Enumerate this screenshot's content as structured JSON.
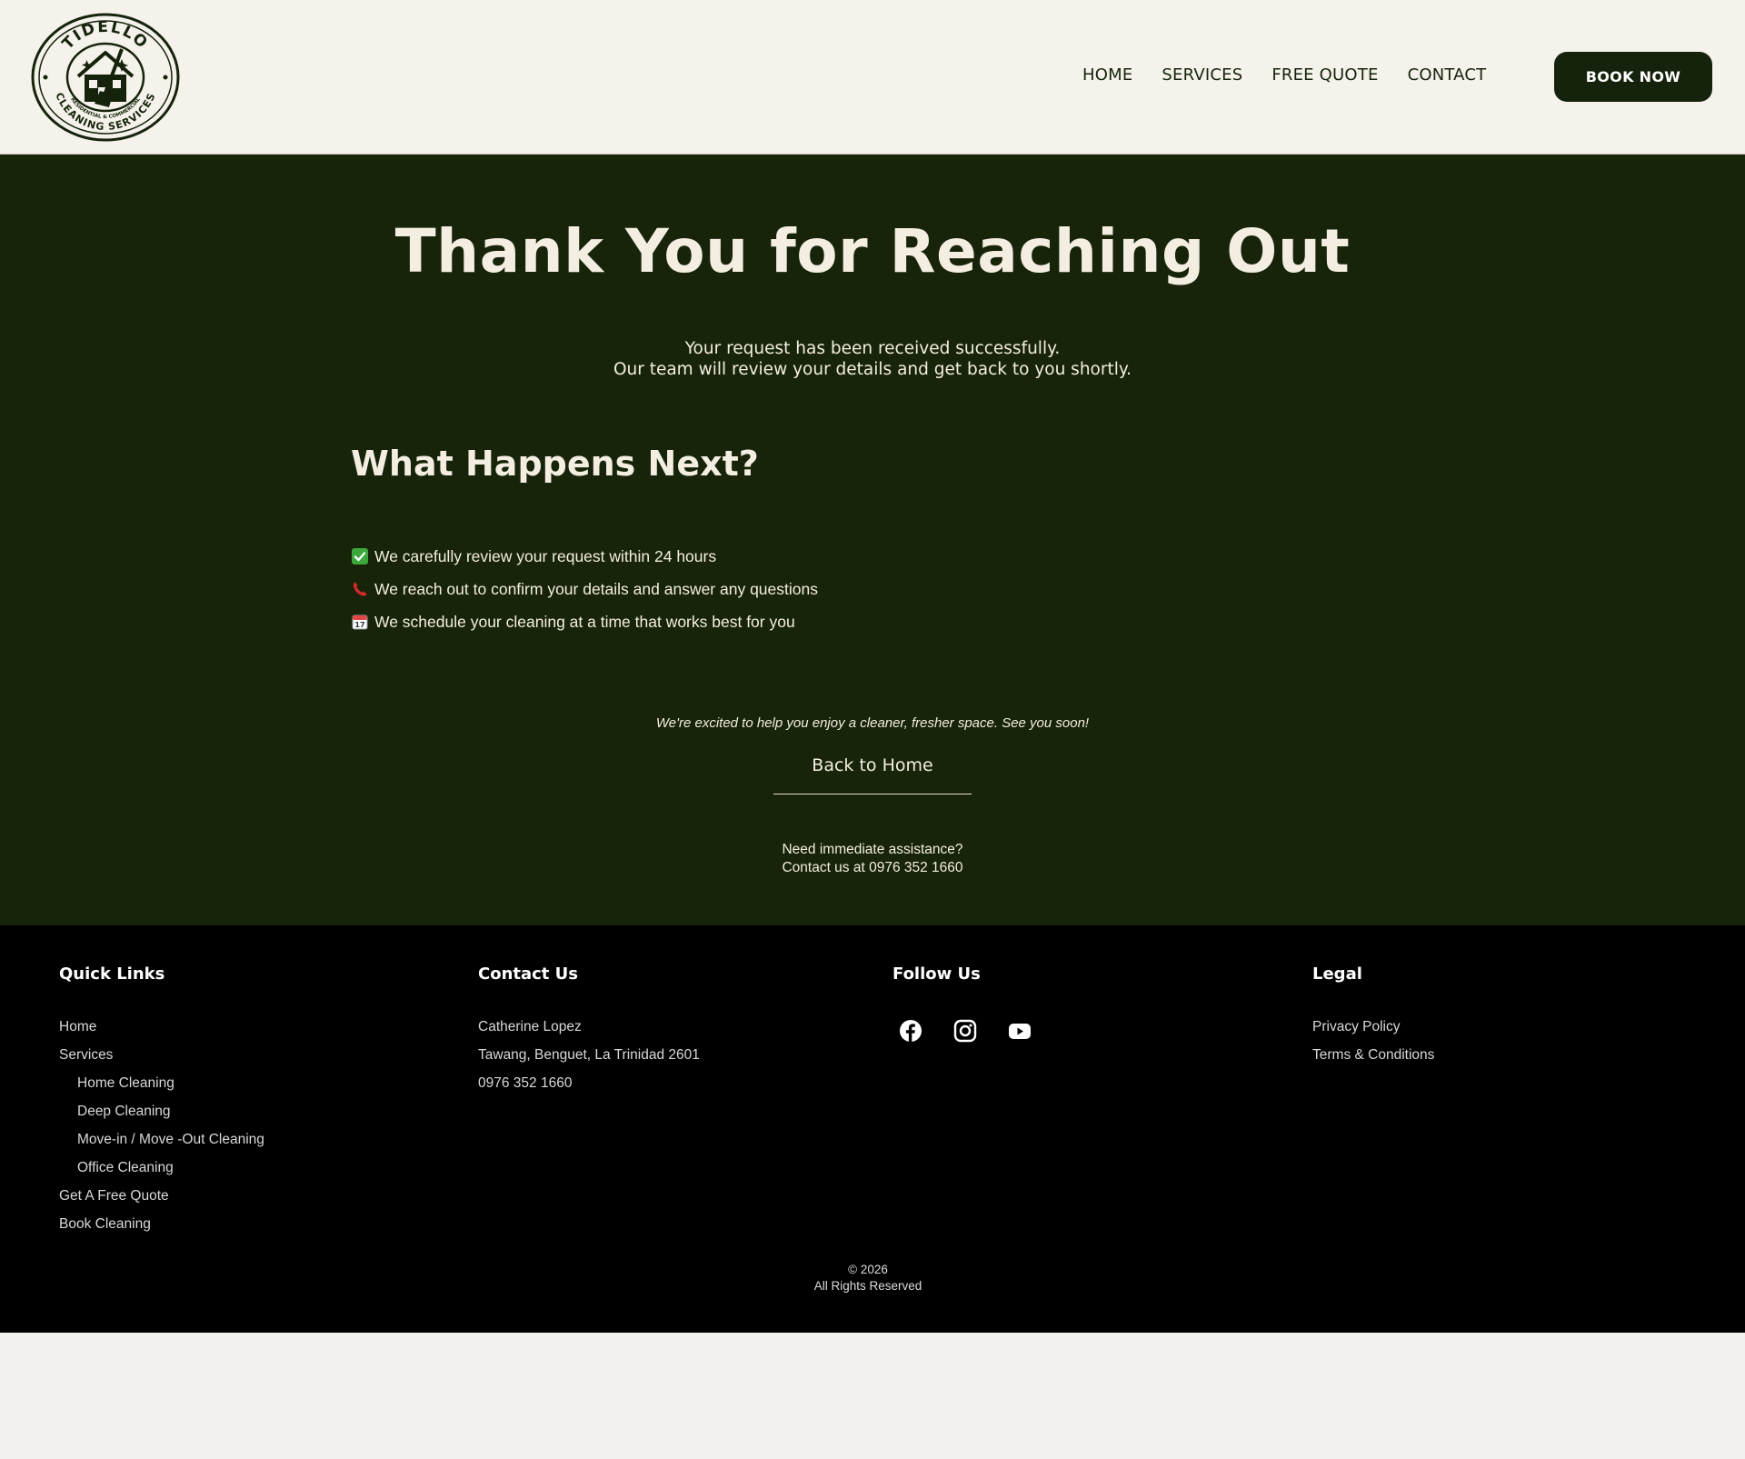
{
  "brand": {
    "name": "TIDELLO",
    "tagline": "CLEANING SERVICES",
    "subtag": "RESIDENTIAL & COMMERCIAL",
    "primary_color": "#16230c",
    "cream_color": "#f4f2ea"
  },
  "nav": {
    "items": [
      "HOME",
      "SERVICES",
      "FREE QUOTE",
      "CONTACT"
    ],
    "book_label": "BOOK NOW"
  },
  "hero": {
    "title": "Thank You for Reaching Out",
    "sub_line1": "Your request has been received successfully.",
    "sub_line2": "Our team will review your details and get back to you shortly.",
    "next_title": "What Happens Next?",
    "steps": [
      {
        "icon": "check-icon",
        "text": "We carefully review your request within 24 hours"
      },
      {
        "icon": "phone-icon",
        "text": "We reach out to confirm your details and answer any questions"
      },
      {
        "icon": "calendar-icon",
        "text": "We schedule your cleaning at a time that works best for you"
      }
    ],
    "excited": "We're excited to help you enjoy a cleaner, fresher space. See you soon!",
    "back_home": "Back to Home",
    "assist_line1": "Need immediate assistance?",
    "assist_line2": "Contact us at 0976 352 1660"
  },
  "footer": {
    "quick_links": {
      "title": "Quick Links",
      "items": [
        "Home",
        "Services",
        "Home Cleaning",
        "Deep Cleaning",
        "Move-in / Move -Out Cleaning",
        "Office Cleaning",
        "Get A Free Quote",
        "Book Cleaning"
      ]
    },
    "contact": {
      "title": "Contact Us",
      "name": "Catherine Lopez",
      "address": "Tawang, Benguet, La Trinidad 2601",
      "phone": "0976 352 1660"
    },
    "follow": {
      "title": "Follow Us",
      "icons": [
        "facebook-icon",
        "instagram-icon",
        "youtube-icon"
      ]
    },
    "legal": {
      "title": "Legal",
      "items": [
        "Privacy Policy",
        "Terms & Conditions"
      ]
    },
    "copyright_line1": "© 2026",
    "copyright_line2": "All Rights Reserved"
  }
}
